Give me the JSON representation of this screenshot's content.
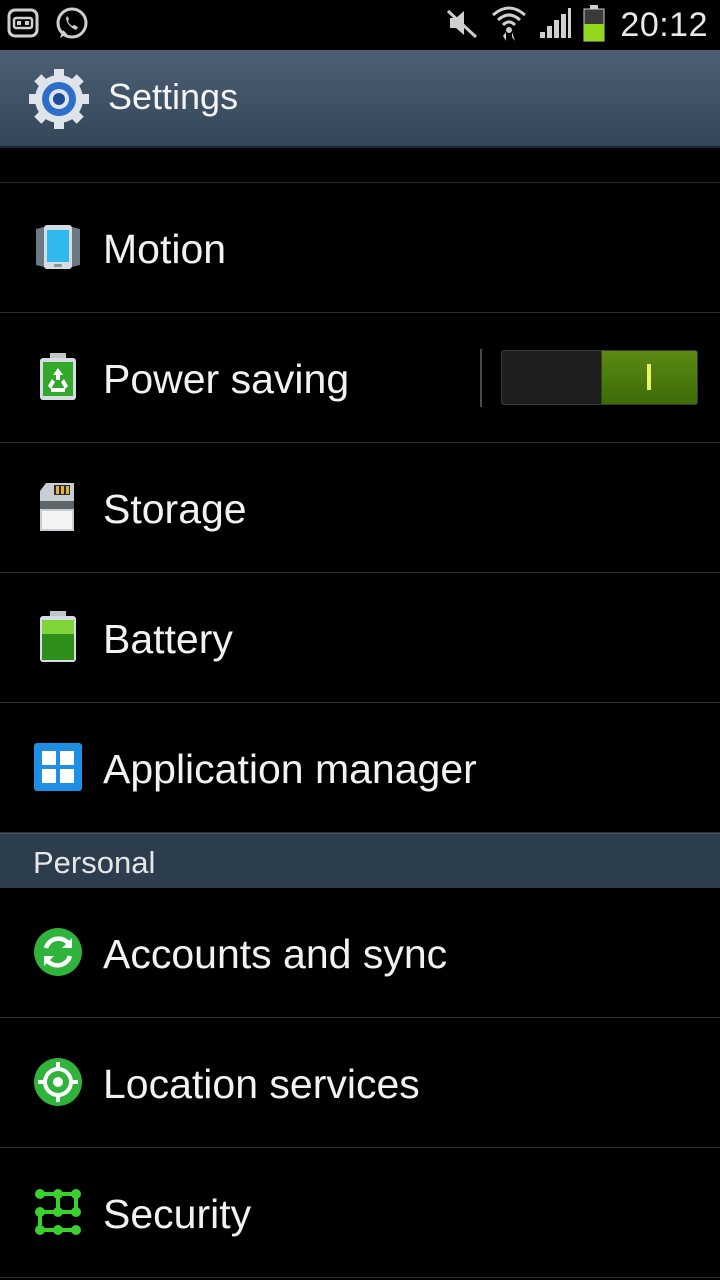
{
  "status_bar": {
    "time": "20:12",
    "icons": [
      "notification-icon",
      "whatsapp-icon",
      "mute-icon",
      "wifi-icon",
      "signal-icon",
      "battery-icon"
    ]
  },
  "action_bar": {
    "title": "Settings",
    "icon": "settings-gear-icon"
  },
  "items": [
    {
      "label": "Motion",
      "icon": "motion-icon"
    },
    {
      "label": "Power saving",
      "icon": "power-saving-icon",
      "toggle": true
    },
    {
      "label": "Storage",
      "icon": "storage-icon"
    },
    {
      "label": "Battery",
      "icon": "battery-icon"
    },
    {
      "label": "Application manager",
      "icon": "application-manager-icon"
    }
  ],
  "section": {
    "label": "Personal"
  },
  "personal_items": [
    {
      "label": "Accounts and sync",
      "icon": "sync-icon"
    },
    {
      "label": "Location services",
      "icon": "location-icon"
    },
    {
      "label": "Security",
      "icon": "security-pattern-icon"
    }
  ],
  "colors": {
    "action_bar": "#3f5264",
    "section_header": "#2c3d4e",
    "toggle_on": "#4f7d10",
    "accent_green": "#35b52a"
  }
}
